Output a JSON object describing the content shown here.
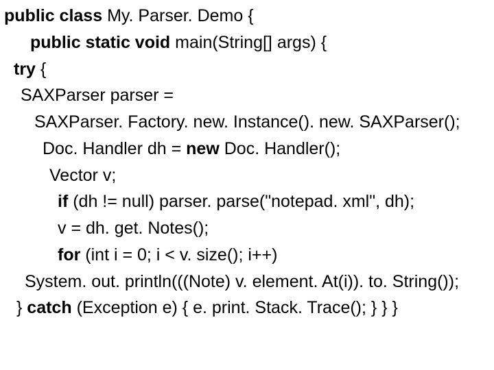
{
  "code": {
    "l1a": "public class ",
    "l1b": "My. Parser. Demo {",
    "l2a": "public static void ",
    "l2b": "main(String[] args) {",
    "l3a": "try ",
    "l3b": "{",
    "l4": "SAXParser parser =",
    "l5": "SAXParser. Factory. new. Instance(). new. SAXParser();",
    "l6a": "Doc. Handler dh = ",
    "l6b": "new ",
    "l6c": "Doc. Handler();",
    "l7": "Vector v;",
    "l8a": "if ",
    "l8b": "(dh != null) parser. parse(\"notepad. xml\", dh);",
    "l9": "v = dh. get. Notes();",
    "l10a": "for ",
    "l10b": "(int i = 0; i < v. size(); i++)",
    "l11": "System. out. println(((Note) v. element. At(i)). to. String());",
    "l12a": "} ",
    "l12b": "catch ",
    "l12c": "(Exception e) { e. print. Stack. Trace(); } } }"
  }
}
